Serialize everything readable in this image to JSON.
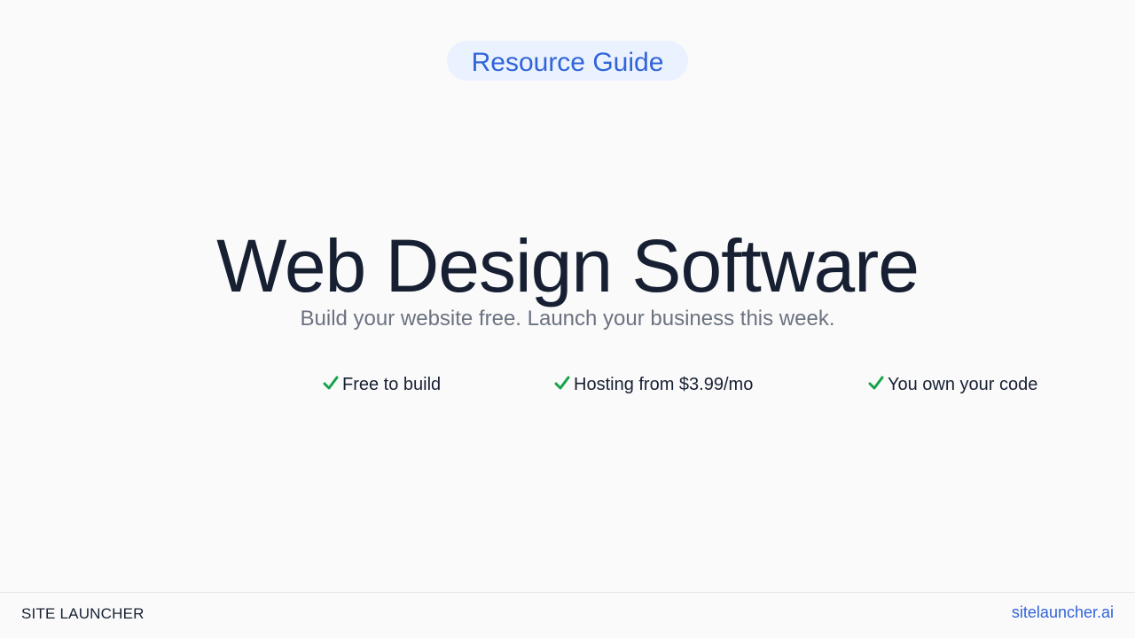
{
  "badge": {
    "label": "Resource Guide"
  },
  "hero": {
    "title": "Web Design Software",
    "subtitle": "Build your website free. Launch your business this week."
  },
  "features": [
    {
      "icon": "checkmark-icon",
      "label": "Free to build"
    },
    {
      "icon": "checkmark-icon",
      "label": "Hosting from $3.99/mo"
    },
    {
      "icon": "checkmark-icon",
      "label": "You own your code"
    }
  ],
  "footer": {
    "brand": "SITE LAUNCHER",
    "link": "sitelauncher.ai"
  },
  "colors": {
    "accent": "#3164d9",
    "badge_bg": "#eaf2ff",
    "heading": "#172033",
    "muted": "#6b7280",
    "check": "#16a34a"
  }
}
